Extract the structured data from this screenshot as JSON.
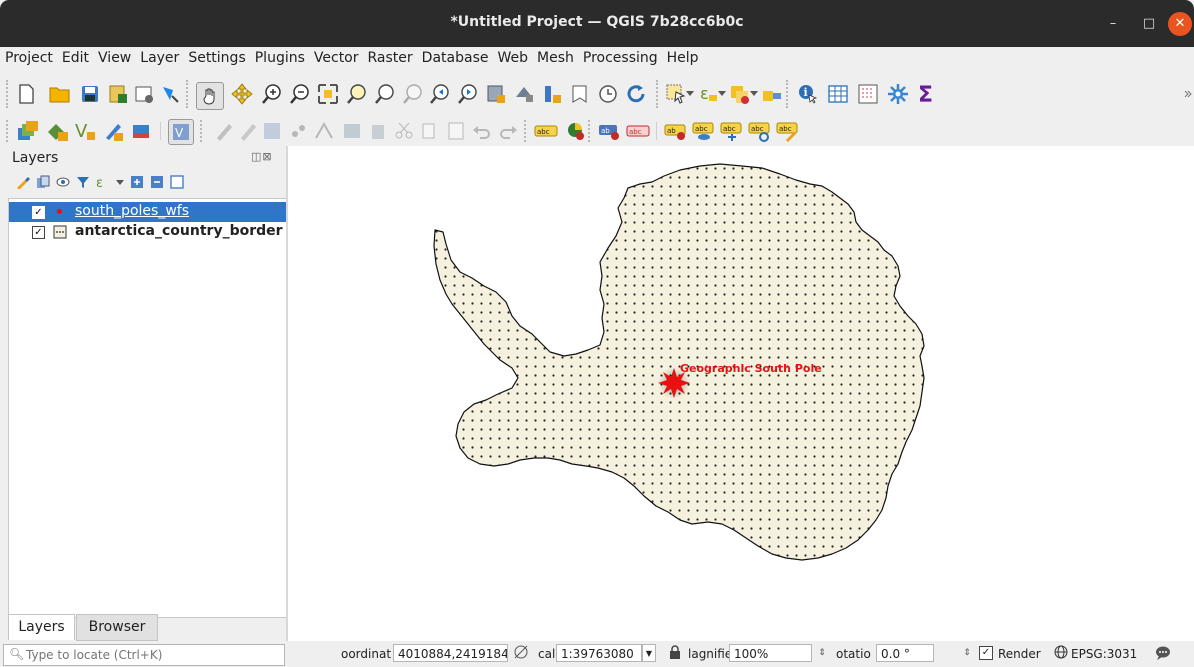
{
  "window": {
    "title": "*Untitled Project — QGIS 7b28cc6b0c",
    "min": "–",
    "max": "□",
    "close": "✕"
  },
  "menu": [
    "Project",
    "Edit",
    "View",
    "Layer",
    "Settings",
    "Plugins",
    "Vector",
    "Raster",
    "Database",
    "Web",
    "Mesh",
    "Processing",
    "Help"
  ],
  "layers_panel": {
    "title": "Layers",
    "float_close": "◫⊠",
    "layers": [
      {
        "name": "south_poles_wfs",
        "checked": "✓",
        "selected": true,
        "icon": "point-layer-icon"
      },
      {
        "name": "antarctica_country_border",
        "checked": "✓",
        "selected": false,
        "icon": "polygon-layer-icon"
      }
    ],
    "tabs": [
      "Layers",
      "Browser"
    ]
  },
  "map": {
    "label": "Geographic South Pole"
  },
  "status": {
    "locate_placeholder": "Type to locate (Ctrl+K)",
    "coordinate_label": "oordinat",
    "coordinate_value": "4010884,2419184",
    "scale_label": "cal",
    "scale_value": "1:39763080",
    "magnifier_label": "lagnifie",
    "magnifier_value": "100%",
    "rotation_label": "otatio",
    "rotation_value": "0.0 °",
    "render_label": "Render",
    "render_checked": "✓",
    "crs": "EPSG:3031"
  },
  "colors": {
    "accent": "#2f75c8",
    "close": "#e95420",
    "marker": "#e81010",
    "polygon_fill": "#f5f1de"
  }
}
